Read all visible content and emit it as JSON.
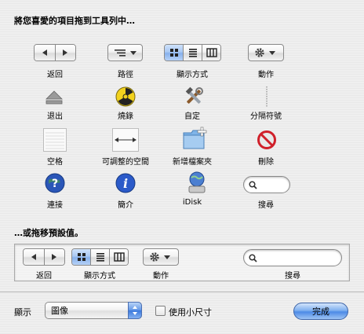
{
  "header": {
    "drag_prompt": "將您喜愛的項目拖到工具列中…",
    "default_prompt": "…或拖移預設值。"
  },
  "items": {
    "back": "返回",
    "path": "路徑",
    "view": "顯示方式",
    "action": "動作",
    "eject": "退出",
    "burn": "燒錄",
    "customize": "自定",
    "separator": "分隔符號",
    "space": "空格",
    "flexible_space": "可調整的空間",
    "new_folder": "新增檔案夾",
    "delete": "刪除",
    "connect": "連接",
    "get_info": "簡介",
    "idisk": "iDisk",
    "search": "搜尋"
  },
  "default_set": {
    "back": "返回",
    "view": "顯示方式",
    "action": "動作",
    "search": "搜尋"
  },
  "footer": {
    "show_label": "顯示",
    "show_value": "圖像",
    "small_size_label": "使用小尺寸",
    "small_size_checked": false,
    "done_label": "完成"
  },
  "colors": {
    "selected_segment": "#87b1ec",
    "primary_button": "#4c8ae6"
  }
}
